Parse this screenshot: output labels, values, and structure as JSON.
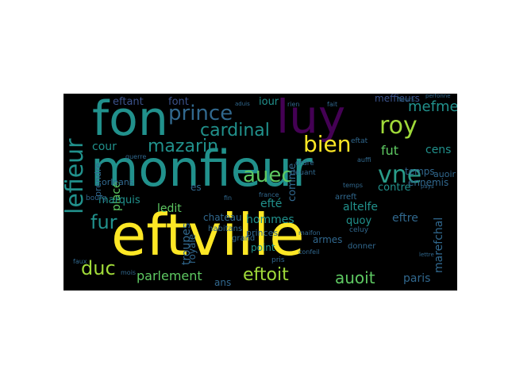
{
  "colors": {
    "page_background": "#ffffff",
    "cloud_background": "#000000",
    "palette": {
      "yellow": "#fde725",
      "green": "#5ec962",
      "lightgreen": "#a0da39",
      "teal": "#21918c",
      "teal2": "#2a9d8a",
      "blue": "#3b528b",
      "blue2": "#31688e",
      "purple": "#440154",
      "purple2": "#482878"
    }
  },
  "word_cloud": {
    "words": [
      {
        "id": "monfieur",
        "text": "monfieur",
        "color": "teal"
      },
      {
        "id": "eftville",
        "text": "eftville",
        "color": "yellow"
      },
      {
        "id": "fon",
        "text": "fon",
        "color": "teal"
      },
      {
        "id": "luy",
        "text": "luy",
        "color": "purple"
      },
      {
        "id": "prince",
        "text": "prince",
        "color": "blue2"
      },
      {
        "id": "cardinal",
        "text": "cardinal",
        "color": "teal"
      },
      {
        "id": "roy",
        "text": "roy",
        "color": "lightgreen"
      },
      {
        "id": "bien",
        "text": "bien",
        "color": "yellow"
      },
      {
        "id": "auec",
        "text": "auec",
        "color": "green"
      },
      {
        "id": "vne",
        "text": "vne",
        "color": "teal2"
      },
      {
        "id": "mazarin",
        "text": "mazarin",
        "color": "teal"
      },
      {
        "id": "lefieur",
        "text": "lefieur",
        "color": "teal"
      },
      {
        "id": "fur",
        "text": "fur",
        "color": "teal"
      },
      {
        "id": "duc",
        "text": "duc",
        "color": "lightgreen"
      },
      {
        "id": "parlement",
        "text": "parlement",
        "color": "green"
      },
      {
        "id": "eftoit",
        "text": "eftoit",
        "color": "lightgreen"
      },
      {
        "id": "auoit",
        "text": "auoit",
        "color": "green"
      },
      {
        "id": "paris",
        "text": "paris",
        "color": "blue2"
      },
      {
        "id": "mefme",
        "text": "mefme",
        "color": "teal"
      },
      {
        "id": "fut",
        "text": "fut",
        "color": "green"
      },
      {
        "id": "cens",
        "text": "cens",
        "color": "teal"
      },
      {
        "id": "eftant",
        "text": "eftant",
        "color": "blue"
      },
      {
        "id": "font",
        "text": "font",
        "color": "blue"
      },
      {
        "id": "meffieurs",
        "text": "meffieurs",
        "color": "blue"
      },
      {
        "id": "iour",
        "text": "iour",
        "color": "teal"
      },
      {
        "id": "cour",
        "text": "cour",
        "color": "teal"
      },
      {
        "id": "place",
        "text": "place",
        "color": "green"
      },
      {
        "id": "marquis",
        "text": "marquis",
        "color": "teal"
      },
      {
        "id": "ledit",
        "text": "ledit",
        "color": "green"
      },
      {
        "id": "hommes",
        "text": "hommes",
        "color": "teal"
      },
      {
        "id": "troupes",
        "text": "troupes",
        "color": "blue2"
      },
      {
        "id": "royale",
        "text": "royale",
        "color": "blue2"
      },
      {
        "id": "chateau",
        "text": "chateau",
        "color": "blue2"
      },
      {
        "id": "contre",
        "text": "contre",
        "color": "teal"
      },
      {
        "id": "temps",
        "text": "temps",
        "color": "blue2"
      },
      {
        "id": "ennemis",
        "text": "ennemis",
        "color": "blue2"
      },
      {
        "id": "eftre",
        "text": "eftre",
        "color": "blue2"
      },
      {
        "id": "marefchal",
        "text": "marefchal",
        "color": "blue2"
      },
      {
        "id": "altelfe",
        "text": "altelfe",
        "color": "teal"
      },
      {
        "id": "quoy",
        "text": "quoy",
        "color": "teal"
      },
      {
        "id": "armes",
        "text": "armes",
        "color": "blue2"
      },
      {
        "id": "efte",
        "text": "efté",
        "color": "teal"
      },
      {
        "id": "comme",
        "text": "comme",
        "color": "blue2"
      },
      {
        "id": "point",
        "text": "point",
        "color": "teal"
      },
      {
        "id": "princes",
        "text": "princes",
        "color": "blue2"
      },
      {
        "id": "ans",
        "text": "ans",
        "color": "blue2"
      },
      {
        "id": "grand",
        "text": "grand",
        "color": "blue2"
      },
      {
        "id": "auoir",
        "text": "auoir",
        "color": "blue2"
      },
      {
        "id": "orleans",
        "text": "orleans",
        "color": "blue2"
      },
      {
        "id": "bourg",
        "text": "bourg",
        "color": "blue2"
      },
      {
        "id": "es",
        "text": "es",
        "color": "blue2"
      },
      {
        "id": "prendre",
        "text": "prendre",
        "color": "blue2"
      },
      {
        "id": "habitans",
        "text": "habitans",
        "color": "blue2"
      },
      {
        "id": "arreft",
        "text": "arreft",
        "color": "blue2"
      },
      {
        "id": "celuy",
        "text": "celuy",
        "color": "blue2"
      },
      {
        "id": "ordre",
        "text": "ordre",
        "color": "blue2"
      },
      {
        "id": "deuant",
        "text": "deuant",
        "color": "blue2"
      },
      {
        "id": "mois",
        "text": "mois",
        "color": "blue2"
      },
      {
        "id": "faux",
        "text": "faux",
        "color": "blue2"
      },
      {
        "id": "rien",
        "text": "rien",
        "color": "blue2"
      },
      {
        "id": "eftat",
        "text": "eftat",
        "color": "blue2"
      },
      {
        "id": "donner",
        "text": "donner",
        "color": "blue2"
      },
      {
        "id": "conseil",
        "text": "confeil",
        "color": "blue2"
      },
      {
        "id": "france",
        "text": "france",
        "color": "blue2"
      },
      {
        "id": "fieurs",
        "text": "fieurs",
        "color": "blue2"
      },
      {
        "id": "perfonne",
        "text": "perfonne",
        "color": "blue2"
      },
      {
        "id": "guerre",
        "text": "guerre",
        "color": "blue2"
      },
      {
        "id": "aduis",
        "text": "aduis",
        "color": "blue2"
      },
      {
        "id": "temps2",
        "text": "temps",
        "color": "blue2"
      },
      {
        "id": "pays",
        "text": "pays",
        "color": "blue2"
      },
      {
        "id": "fait",
        "text": "fait",
        "color": "blue2"
      },
      {
        "id": "fin",
        "text": "fin",
        "color": "blue2"
      },
      {
        "id": "pris",
        "text": "pris",
        "color": "blue2"
      },
      {
        "id": "auffi",
        "text": "auffi",
        "color": "blue2"
      },
      {
        "id": "maifon",
        "text": "maifon",
        "color": "blue2"
      },
      {
        "id": "lettre",
        "text": "lettre",
        "color": "blue2"
      }
    ]
  }
}
